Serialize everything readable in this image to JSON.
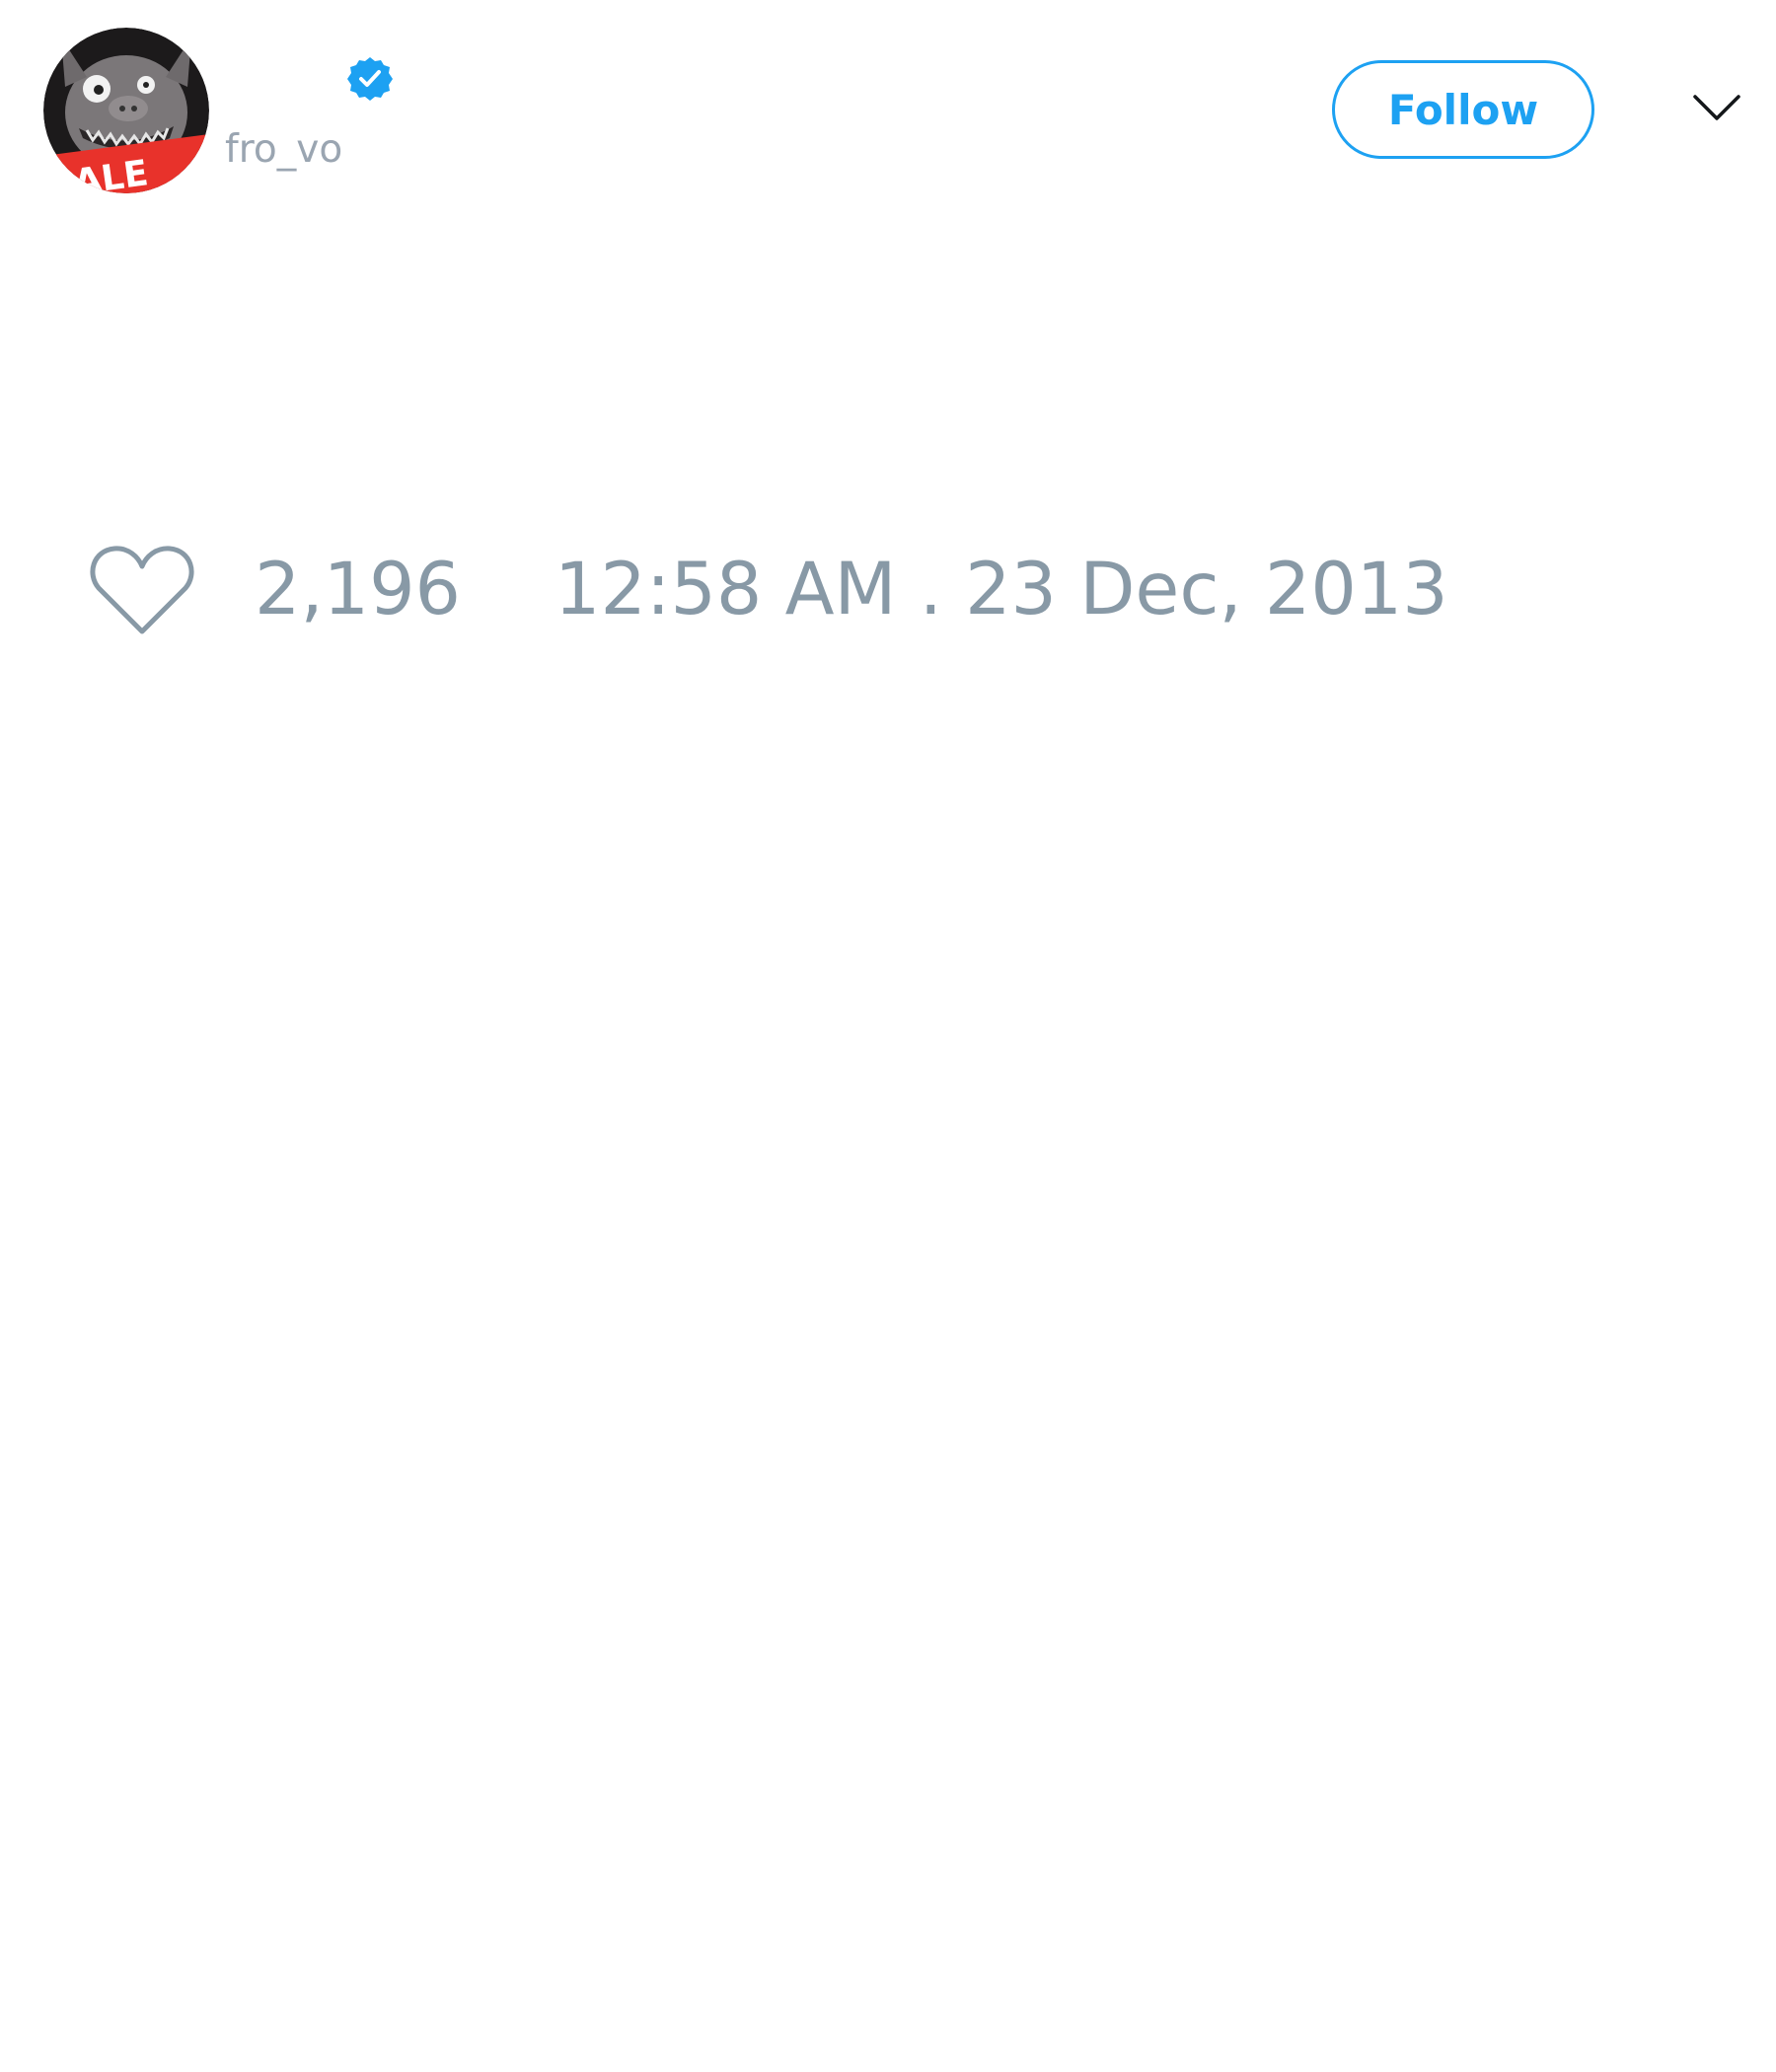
{
  "tweet": {
    "author": {
      "handle": "fro_vo",
      "verified": true,
      "avatar_badge_text": "SALE"
    },
    "follow_label": "Follow",
    "likes": "2,196",
    "timestamp": "12:58 AM . 23 Dec, 2013"
  },
  "icons": {
    "verified": "verified-badge-icon",
    "menu": "chevron-down-icon",
    "like": "heart-icon"
  },
  "colors": {
    "accent": "#1da1f2",
    "muted_text": "#8899a6",
    "handle_text": "#9aa5b1",
    "chevron": "#14171a",
    "heart_outline": "#8899a6",
    "sale_red": "#e8322b"
  }
}
